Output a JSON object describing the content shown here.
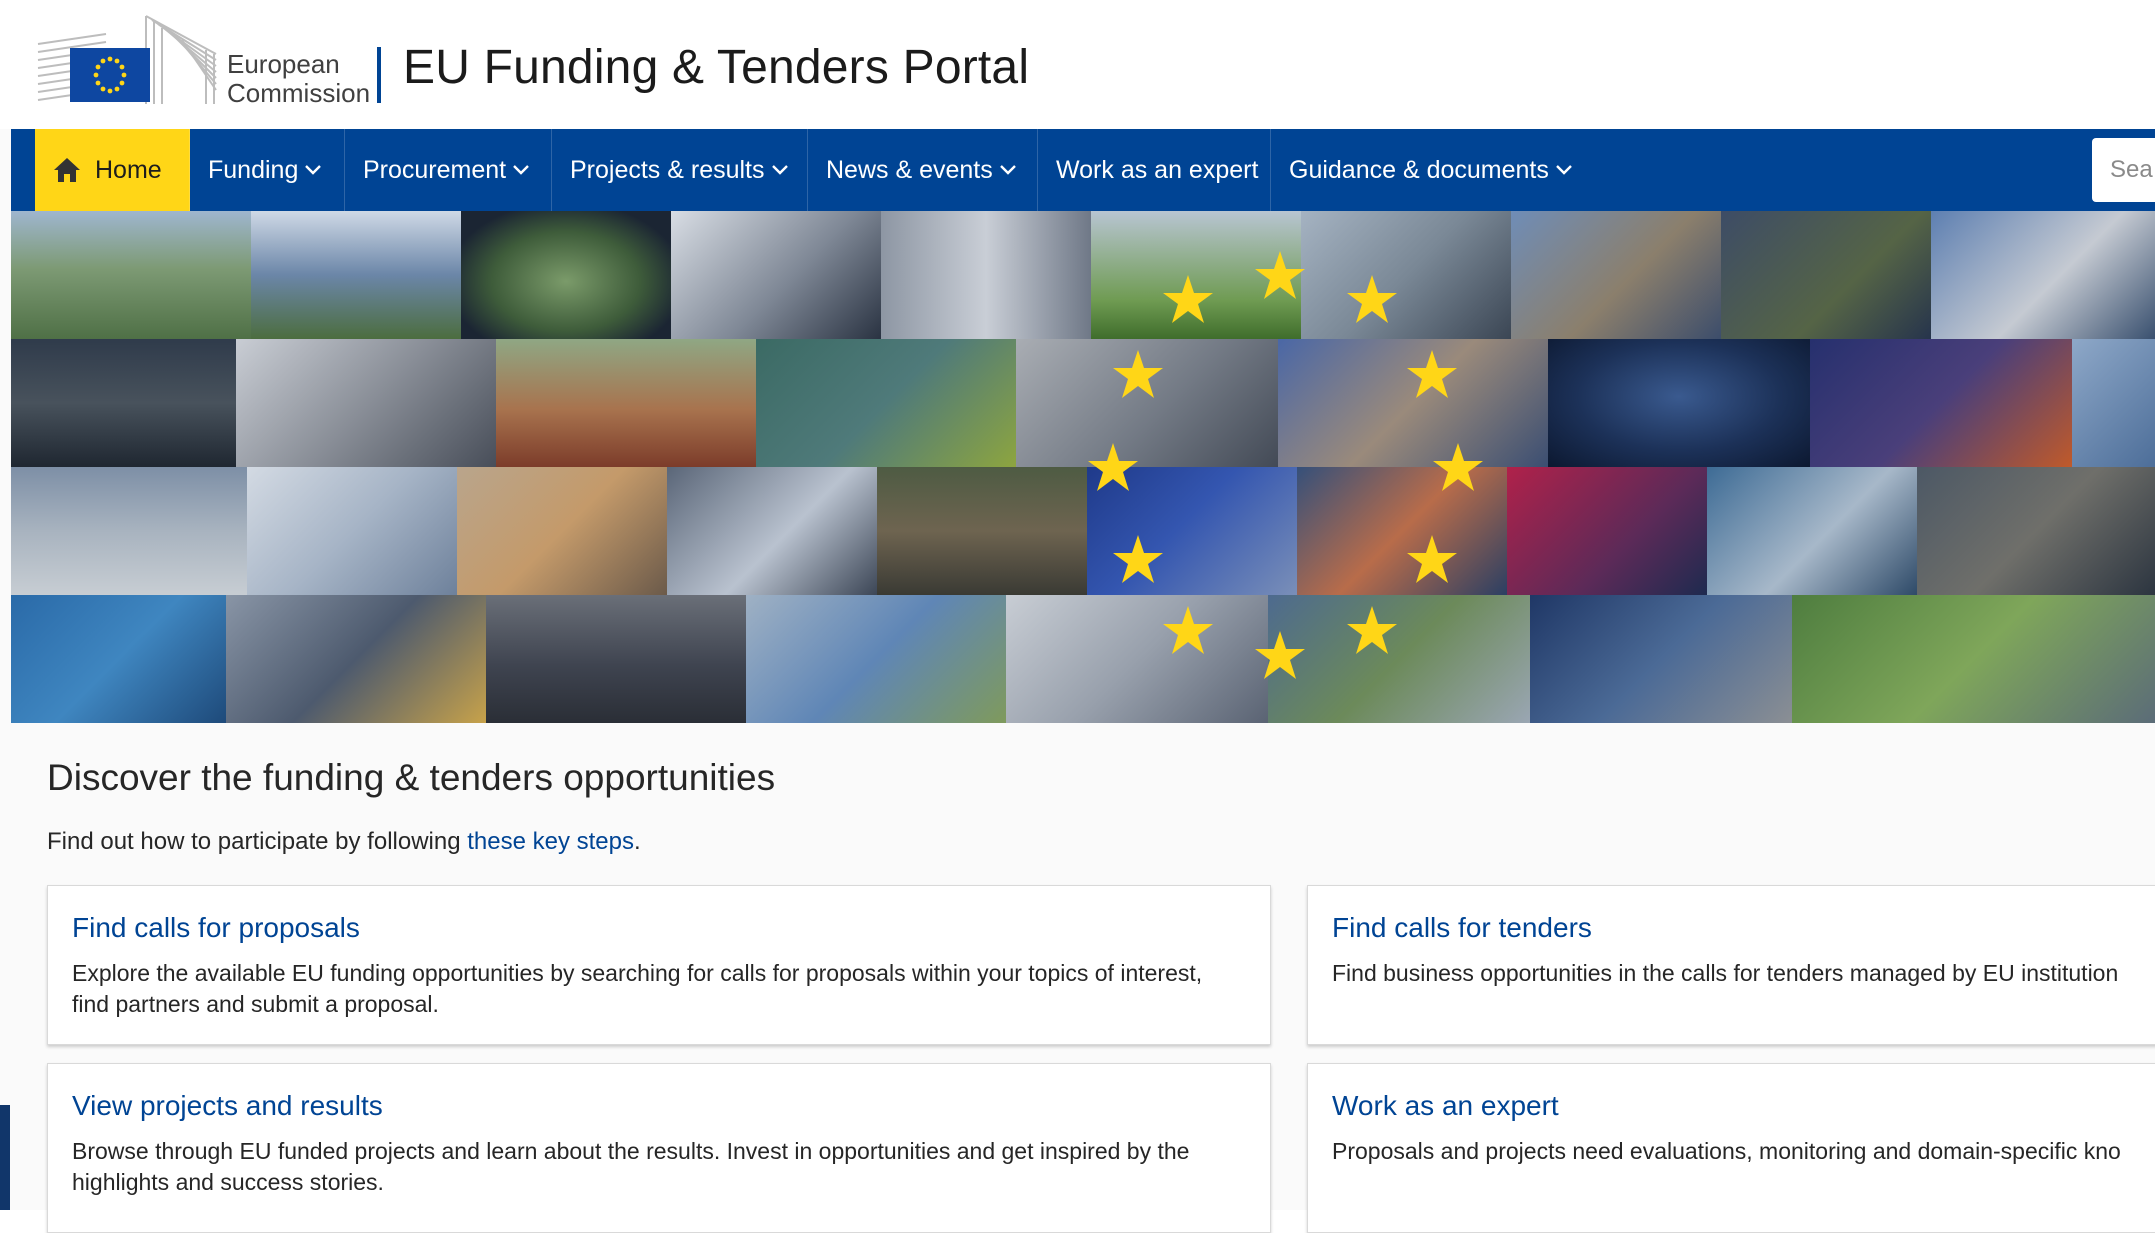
{
  "header": {
    "ec_line1": "European",
    "ec_line2": "Commission",
    "portal_title": "EU Funding & Tenders Portal"
  },
  "nav": {
    "home": "Home",
    "funding": "Funding",
    "procurement": "Procurement",
    "projects": "Projects & results",
    "news": "News & events",
    "expert": "Work as an expert",
    "guidance": "Guidance & documents",
    "search_placeholder": "Sea"
  },
  "colors": {
    "brand_blue": "#004494",
    "home_yellow": "#ffd617",
    "star_yellow": "#ffd617",
    "link_blue": "#004494"
  },
  "icons": [
    "home-icon",
    "chevron-down-icon",
    "eu-flag-icon",
    "star-icon"
  ],
  "content": {
    "discover_title": "Discover the funding & tenders opportunities",
    "discover_sub_prefix": "Find out how to participate by following ",
    "discover_sub_link": "these key steps",
    "discover_sub_suffix": "."
  },
  "cards": [
    {
      "title": "Find calls for proposals",
      "text": "Explore the available EU funding opportunities by searching for calls for proposals within your topics of interest, find partners and submit a proposal."
    },
    {
      "title": "Find calls for tenders",
      "text": "Find business opportunities in the calls for tenders managed by EU institution"
    },
    {
      "title": "View projects and results",
      "text": "Browse through EU funded projects and learn about the results. Invest in opportunities and get inspired by the highlights and success stories."
    },
    {
      "title": "Work as an expert",
      "text": "Proposals and projects need evaluations, monitoring and domain-specific kno"
    }
  ]
}
